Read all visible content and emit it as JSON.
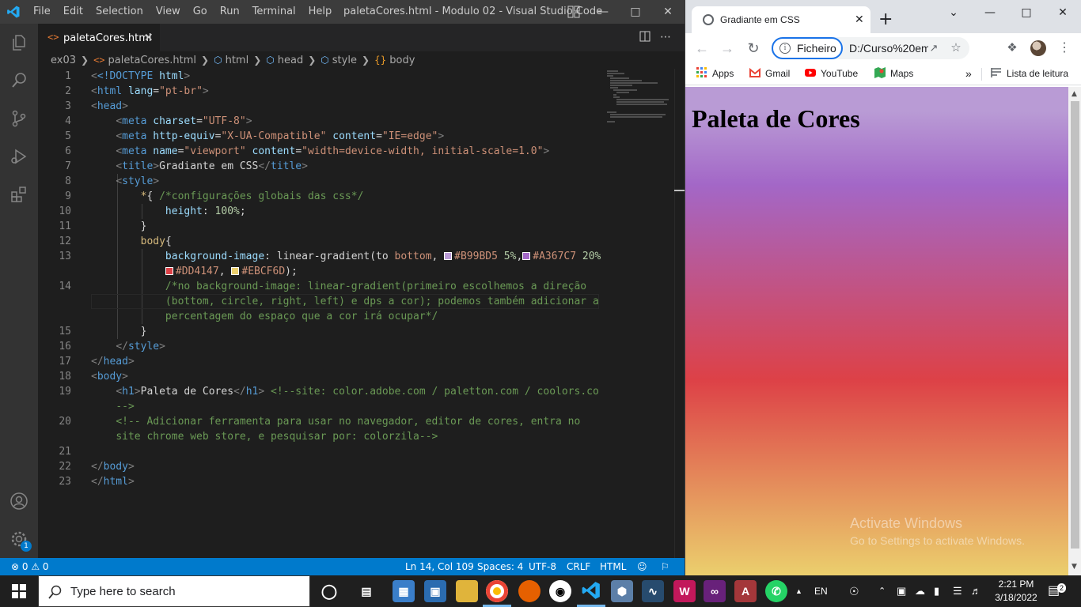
{
  "vscode": {
    "menu": [
      "File",
      "Edit",
      "Selection",
      "View",
      "Go",
      "Run",
      "Terminal",
      "Help"
    ],
    "window_title": "paletaCores.html - Modulo 02 - Visual Studio Code",
    "tab": {
      "icon": "<>",
      "label": "paletaCores.html",
      "close": "✕"
    },
    "breadcrumb": [
      "ex03",
      "paletaCores.html",
      "html",
      "head",
      "style",
      "body"
    ],
    "code": {
      "l1": "1",
      "l2": "2",
      "l3": "3",
      "l4": "4",
      "l5": "5",
      "l6": "6",
      "l7": "7",
      "l8": "8",
      "l9": "9",
      "l10": "10",
      "l11": "11",
      "l12": "12",
      "l13": "13",
      "l14": "14",
      "l15": "15",
      "l16": "16",
      "l17": "17",
      "l18": "18",
      "l19": "19",
      "l20": "20",
      "l21": "21",
      "l22": "22",
      "l23": "23",
      "doctype": "<!DOCTYPE",
      "html_kw": "html",
      "lang_attr": "lang",
      "lang_val": "\"pt-br\"",
      "meta": "meta",
      "charset_attr": "charset",
      "charset_val": "\"UTF-8\"",
      "httpequiv_attr": "http-equiv",
      "httpequiv_val": "\"X-UA-Compatible\"",
      "content_attr": "content",
      "ie_val": "\"IE=edge\"",
      "name_attr": "name",
      "viewport_val": "\"viewport\"",
      "viewport_content": "\"width=device-width, initial-scale=1.0\"",
      "title_tag": "title",
      "title_text": "Gradiante em CSS",
      "style_tag": "style",
      "head_tag": "head",
      "body_tag": "body",
      "h1_tag": "h1",
      "star_sel": "*",
      "brace_open": "{",
      "brace_close": "}",
      "comment_globals": "/*configurações globais das css*/",
      "height_prop": "height",
      "height_val": "100%",
      "body_sel": "body",
      "bgimage_prop": "background-image",
      "lg_func": "linear-gradient(to",
      "lg_bottom": "bottom",
      "c1": "#B99BD5",
      "c1_pct": "5%",
      "c2": "#A367C7",
      "c2_pct": "20%",
      "c3": "#DD4147",
      "c4": "#EBCF6D",
      "comment_bg_1": "/*no background-image: linear-gradient(primeiro escolhemos a direção",
      "comment_bg_2": "(bottom, circle, right, left) e dps a cor); podemos também adicionar a",
      "comment_bg_3": "percentagem do espaço que a cor irá ocupar*/",
      "h1_text": "Paleta de Cores",
      "comment_site_1": "<!--site: color.adobe.com / paletton.com / coolors.co",
      "comment_site_2": "-->",
      "comment_tool_1": "<!-- Adicionar ferramenta para usar no navegador, editor de cores, entra no",
      "comment_tool_2": "site chrome web store, e pesquisar por: colorzila-->"
    },
    "status": {
      "problems": "⊗ 0 ⚠ 0",
      "position": "Ln 14, Col 109",
      "spaces": "Spaces: 4",
      "encoding": "UTF-8",
      "eol": "CRLF",
      "language": "HTML"
    },
    "settings_badge": "1",
    "colors": {
      "status_bar": "#007acc",
      "activity_bar": "#333333",
      "editor_bg": "#1e1e1e"
    }
  },
  "chrome": {
    "tab_title": "Gradiante em CSS",
    "tab_close": "✕",
    "new_tab": "+",
    "site_chip": "Ficheiro",
    "url": "D:/Curso%20em...",
    "bookmarks": [
      "Apps",
      "Gmail",
      "YouTube",
      "Maps"
    ],
    "more_bookmarks": "»",
    "reading_list": "Lista de leitura",
    "page_heading": "Paleta de Cores",
    "watermark_title": "Activate Windows",
    "watermark_sub": "Go to Settings to activate Windows.",
    "gradient_colors": [
      "#B99BD5",
      "#A367C7",
      "#DD4147",
      "#EBCF6D"
    ]
  },
  "taskbar": {
    "search_placeholder": "Type here to search",
    "language": "EN",
    "time": "2:21 PM",
    "date": "3/18/2022",
    "notifications_count": "2"
  }
}
